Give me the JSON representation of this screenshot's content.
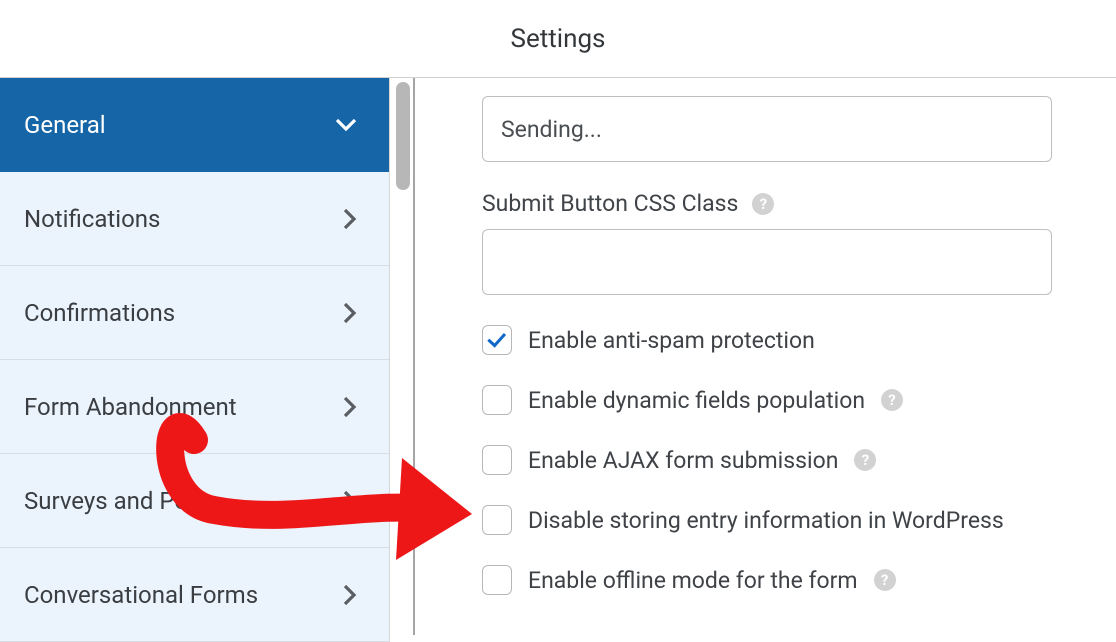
{
  "header": {
    "title": "Settings"
  },
  "sidebar": {
    "items": [
      {
        "label": "General",
        "active": true,
        "expanded": true
      },
      {
        "label": "Notifications"
      },
      {
        "label": "Confirmations"
      },
      {
        "label": "Form Abandonment"
      },
      {
        "label": "Surveys and Polls"
      },
      {
        "label": "Conversational Forms"
      }
    ]
  },
  "form": {
    "processing_text_value": "Sending...",
    "css_class_label": "Submit Button CSS Class",
    "css_class_value": ""
  },
  "options": [
    {
      "label": "Enable anti-spam protection",
      "checked": true,
      "help": false
    },
    {
      "label": "Enable dynamic fields population",
      "checked": false,
      "help": true
    },
    {
      "label": "Enable AJAX form submission",
      "checked": false,
      "help": true
    },
    {
      "label": "Disable storing entry information in WordPress",
      "checked": false,
      "help": false
    },
    {
      "label": "Enable offline mode for the form",
      "checked": false,
      "help": true
    }
  ]
}
